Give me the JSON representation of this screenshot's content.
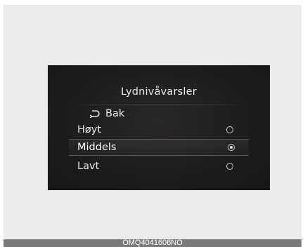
{
  "screen": {
    "title": "Lydnivåvarsler",
    "back": {
      "icon": "return-arrow-icon",
      "label": "Bak"
    },
    "options": [
      {
        "label": "Høyt",
        "selected": false
      },
      {
        "label": "Middels",
        "selected": true
      },
      {
        "label": "Lavt",
        "selected": false
      }
    ]
  },
  "caption": "OMQ4041606NO",
  "colors": {
    "frame_background": "#ebebeb",
    "screen_background": "#1e1c1c",
    "text": "#ececec",
    "caption_bar": "#7a7a7a"
  }
}
